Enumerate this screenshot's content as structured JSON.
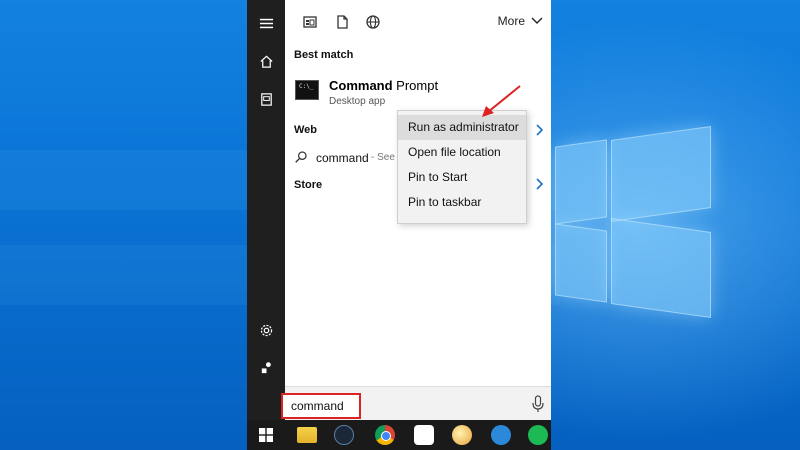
{
  "start_rail": {
    "icons": [
      "hamburger-menu-icon",
      "home-icon",
      "document-icon",
      "settings-gear-icon",
      "feedback-icon"
    ]
  },
  "filters": {
    "icons": [
      "apps-filter-icon",
      "documents-filter-icon",
      "web-filter-icon"
    ],
    "more_label": "More"
  },
  "results": {
    "best_match_heading": "Best match",
    "best_match": {
      "title_bold": "Command",
      "title_rest": " Prompt",
      "subtitle": "Desktop app"
    },
    "web_heading": "Web",
    "web_item": {
      "term": "command",
      "hint": " - See web results"
    },
    "store_heading": "Store"
  },
  "context_menu": {
    "items": [
      "Run as administrator",
      "Open file location",
      "Pin to Start",
      "Pin to taskbar"
    ],
    "highlighted": "Run as administrator"
  },
  "search": {
    "value": "command"
  },
  "taskbar": {
    "apps": [
      "file-explorer",
      "steam",
      "chrome",
      "slack",
      "paint",
      "simplenote",
      "spotify"
    ]
  },
  "colors": {
    "accent": "#1a73c8",
    "highlight_box": "#dd2222",
    "arrow": "#dd2222"
  }
}
